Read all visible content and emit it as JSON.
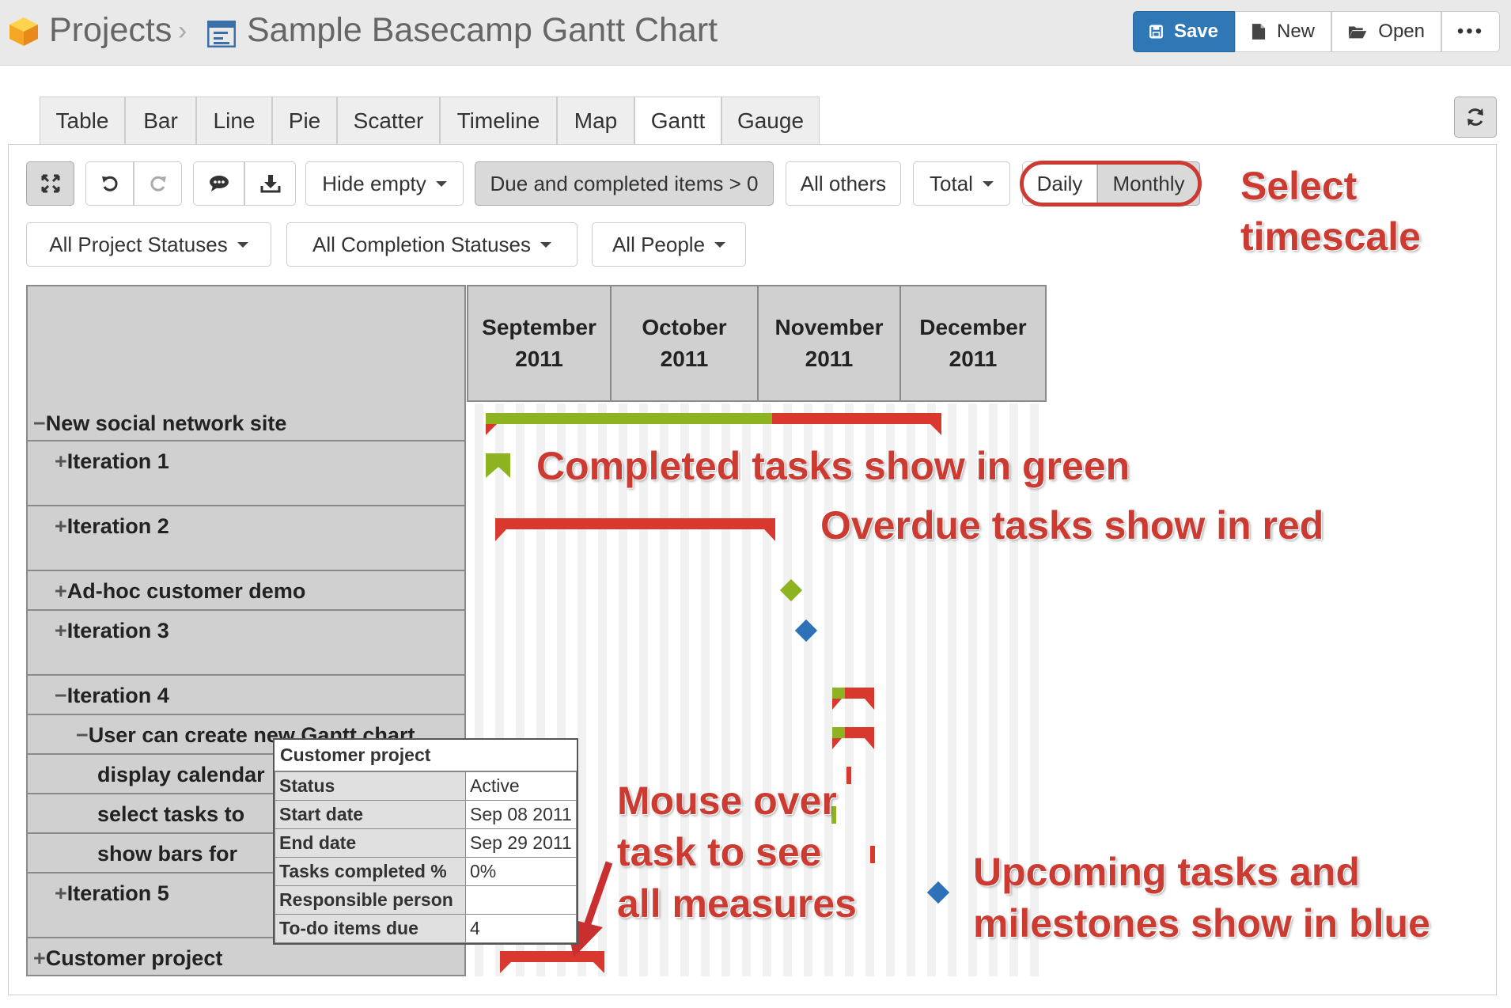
{
  "header": {
    "breadcrumb_root": "Projects",
    "title": "Sample Basecamp Gantt Chart",
    "actions": {
      "save": "Save",
      "new": "New",
      "open": "Open",
      "more": "•••"
    }
  },
  "tabs": [
    "Table",
    "Bar",
    "Line",
    "Pie",
    "Scatter",
    "Timeline",
    "Map",
    "Gantt",
    "Gauge"
  ],
  "active_tab": "Gantt",
  "controls": {
    "hide_empty": "Hide empty",
    "filter_active": "Due and completed items > 0",
    "all_others": "All others",
    "total": "Total",
    "timescale": {
      "daily": "Daily",
      "monthly": "Monthly",
      "selected": "Monthly"
    },
    "project_status": "All Project Statuses",
    "completion_status": "All Completion Statuses",
    "people": "All People"
  },
  "annotations": {
    "select_timescale_1": "Select",
    "select_timescale_2": "timescale",
    "completed": "Completed tasks show in green",
    "overdue": "Overdue tasks show in red",
    "mouse_1": "Mouse over",
    "mouse_2": "task to see",
    "mouse_3": "all measures",
    "upcoming_1": "Upcoming tasks and",
    "upcoming_2": "milestones show in blue"
  },
  "gantt": {
    "months": [
      {
        "name": "September",
        "year": "2011"
      },
      {
        "name": "October",
        "year": "2011"
      },
      {
        "name": "November",
        "year": "2011"
      },
      {
        "name": "December",
        "year": "2011"
      }
    ],
    "rows": [
      {
        "toggle": "−",
        "label": "New social network site"
      },
      {
        "toggle": "+",
        "label": "Iteration 1"
      },
      {
        "toggle": "+",
        "label": "Iteration 2"
      },
      {
        "toggle": "+",
        "label": "Ad-hoc customer demo"
      },
      {
        "toggle": "+",
        "label": "Iteration 3"
      },
      {
        "toggle": "−",
        "label": "Iteration 4"
      },
      {
        "toggle": "−",
        "label": "User can create new Gantt chart"
      },
      {
        "toggle": "",
        "label": "display calendar"
      },
      {
        "toggle": "",
        "label": "select tasks to"
      },
      {
        "toggle": "",
        "label": "show bars for"
      },
      {
        "toggle": "+",
        "label": "Iteration 5"
      },
      {
        "toggle": "+",
        "label": "Customer project"
      }
    ],
    "colors": {
      "completed": "#8db321",
      "overdue": "#d8382e",
      "upcoming": "#2d71b8"
    }
  },
  "tooltip": {
    "title": "Customer project",
    "rows": [
      {
        "key": "Status",
        "value": "Active"
      },
      {
        "key": "Start date",
        "value": "Sep 08 2011"
      },
      {
        "key": "End date",
        "value": "Sep 29 2011"
      },
      {
        "key": "Tasks completed %",
        "value": "0%"
      },
      {
        "key": "Responsible person",
        "value": ""
      },
      {
        "key": "To-do items due",
        "value": "4"
      }
    ]
  }
}
